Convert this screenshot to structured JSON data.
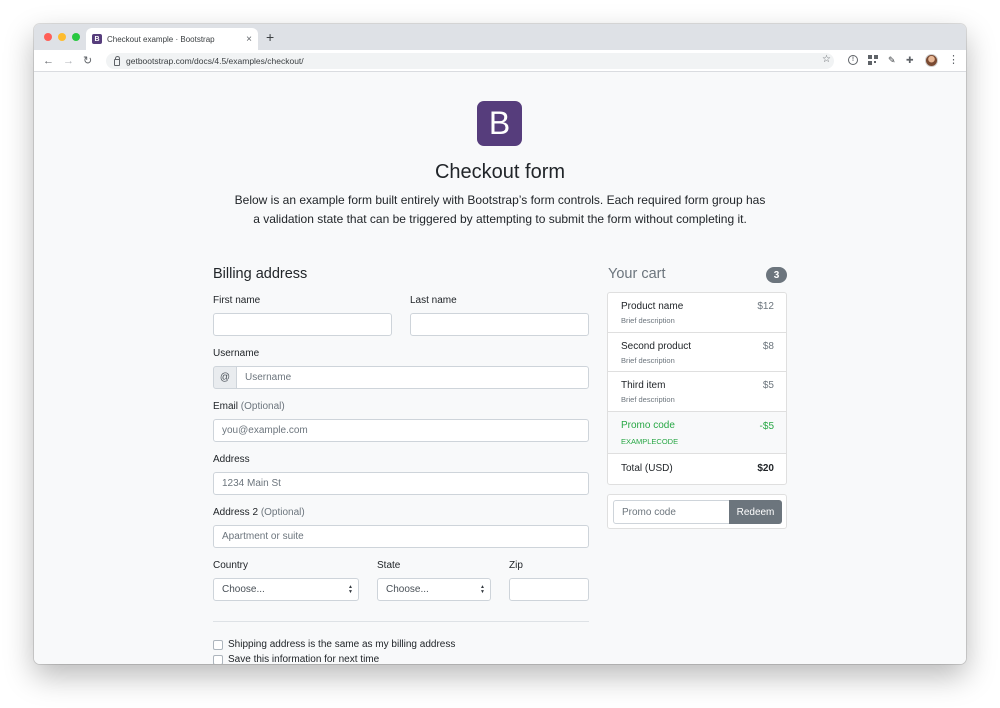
{
  "browser": {
    "tab_title": "Checkout example · Bootstrap",
    "tab_favicon": "B",
    "close_glyph": "×",
    "new_tab_glyph": "+",
    "url": "getbootstrap.com/docs/4.5/examples/checkout/",
    "icons": [
      "back-arrow-icon",
      "forward-arrow-icon",
      "reload-icon",
      "lock-icon",
      "star-icon",
      "info-icon",
      "qr-code-icon",
      "pen-tool-icon",
      "puzzle-icon",
      "avatar",
      "more-menu-icon"
    ],
    "traffic_colors": {
      "close": "#ff5f57",
      "minimize": "#febc2e",
      "zoom": "#28c840"
    }
  },
  "page": {
    "logo_letter": "B",
    "brand_color": "#563d7c",
    "title": "Checkout form",
    "lead": "Below is an example form built entirely with Bootstrap’s form controls. Each required form group has a validation state that can be triggered by attempting to submit the form without completing it."
  },
  "billing": {
    "heading": "Billing address",
    "first_name_label": "First name",
    "last_name_label": "Last name",
    "username_label": "Username",
    "username_addon": "@",
    "username_placeholder": "Username",
    "email_label": "Email",
    "email_optional": "(Optional)",
    "email_placeholder": "you@example.com",
    "address_label": "Address",
    "address_placeholder": "1234 Main St",
    "address2_label": "Address 2",
    "address2_optional": "(Optional)",
    "address2_placeholder": "Apartment or suite",
    "country_label": "Country",
    "country_value": "Choose...",
    "state_label": "State",
    "state_value": "Choose...",
    "zip_label": "Zip",
    "checkbox_same_address": "Shipping address is the same as my billing address",
    "checkbox_save_info": "Save this information for next time"
  },
  "cart": {
    "heading": "Your cart",
    "count": "3",
    "items": [
      {
        "name": "Product name",
        "desc": "Brief description",
        "price": "$12"
      },
      {
        "name": "Second product",
        "desc": "Brief description",
        "price": "$8"
      },
      {
        "name": "Third item",
        "desc": "Brief description",
        "price": "$5"
      }
    ],
    "promo": {
      "name": "Promo code",
      "code": "EXAMPLECODE",
      "amount": "-$5",
      "color": "#28a745"
    },
    "total_label": "Total (USD)",
    "total_value": "$20",
    "promo_placeholder": "Promo code",
    "redeem_label": "Redeem"
  }
}
